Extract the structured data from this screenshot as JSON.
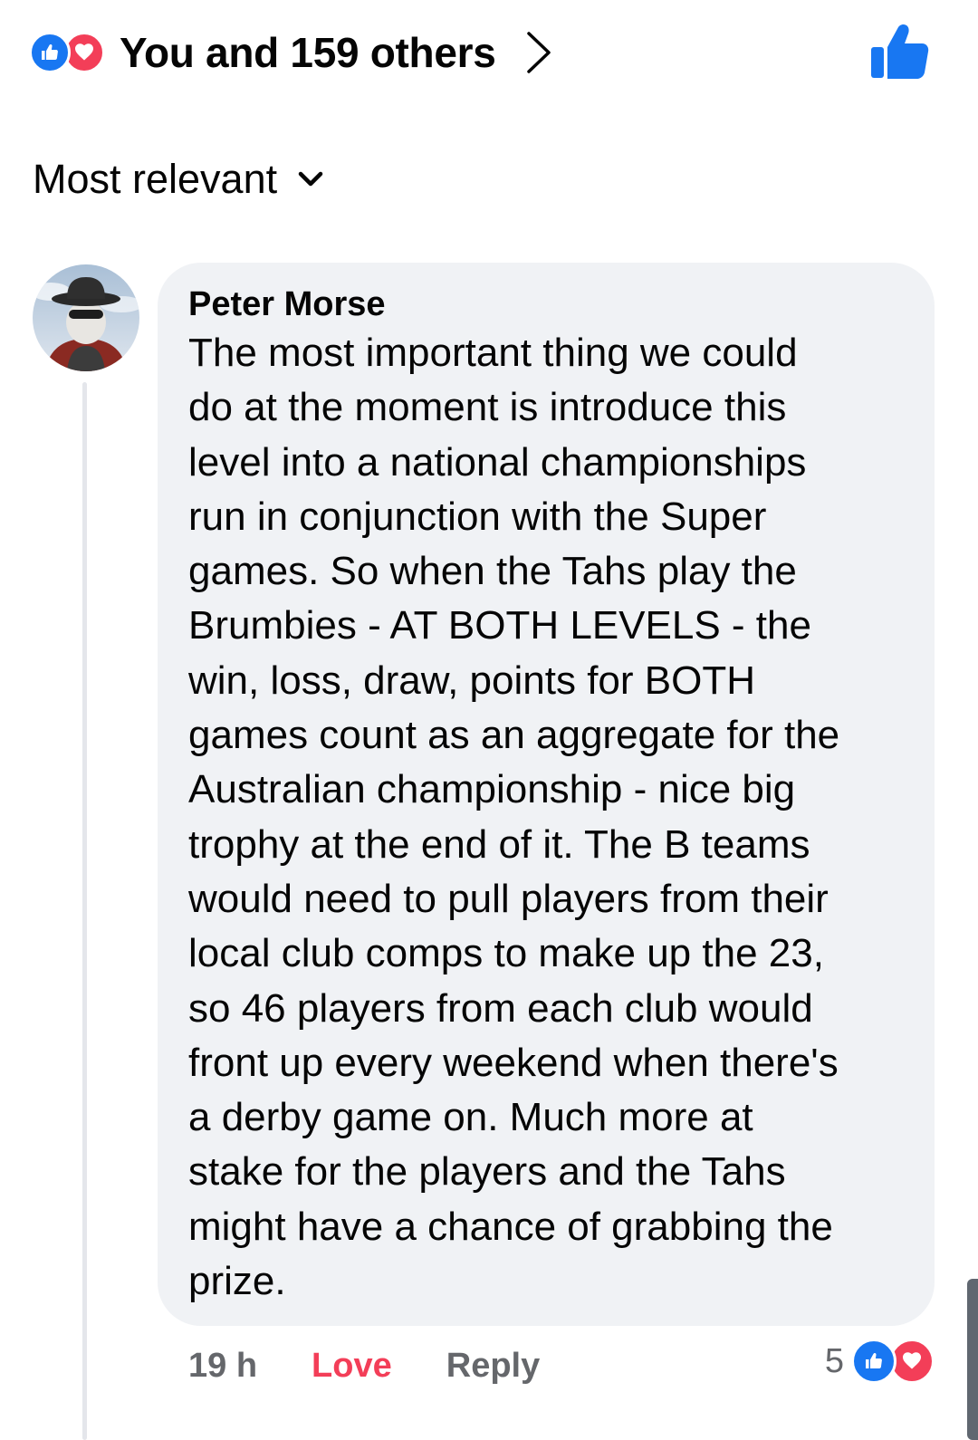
{
  "reactions_summary": {
    "text": "You and 159 others",
    "types": [
      "like-icon",
      "love-icon"
    ],
    "colors": {
      "like": "#1877f2",
      "love": "#f33e58"
    }
  },
  "sort": {
    "label": "Most relevant"
  },
  "comment": {
    "author": "Peter Morse",
    "lines": [
      "The most important thing we could",
      "do at the moment is introduce this",
      "level into a national championships",
      "run in conjunction with the Super",
      "games. So when the Tahs play the",
      "Brumbies - AT BOTH LEVELS - the",
      "win, loss, draw, points for BOTH",
      "games count as an aggregate for the",
      "Australian championship - nice big",
      "trophy at the end of it. The B teams",
      "would need to pull players from their",
      "local club comps to make up the 23,",
      "so 46 players from each club would",
      "front up every weekend when there's",
      "a derby game on. Much more at",
      "stake for the players and the Tahs",
      "might have a chance of grabbing the",
      "prize."
    ],
    "timestamp": "19 h",
    "love_label": "Love",
    "reply_label": "Reply",
    "reaction_count": "5",
    "reaction_types": [
      "like-icon",
      "love-icon"
    ]
  }
}
